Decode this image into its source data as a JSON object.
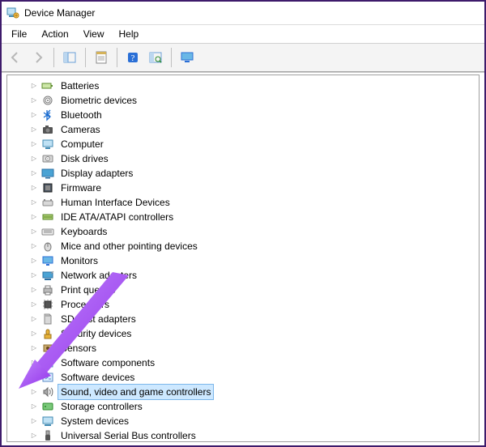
{
  "window": {
    "title": "Device Manager"
  },
  "menu": {
    "items": [
      {
        "key": "file",
        "label": "File"
      },
      {
        "key": "action",
        "label": "Action"
      },
      {
        "key": "view",
        "label": "View"
      },
      {
        "key": "help",
        "label": "Help"
      }
    ]
  },
  "tree": {
    "items": [
      {
        "icon": "battery",
        "label": "Batteries",
        "selected": false
      },
      {
        "icon": "biometric",
        "label": "Biometric devices",
        "selected": false
      },
      {
        "icon": "bluetooth",
        "label": "Bluetooth",
        "selected": false
      },
      {
        "icon": "camera",
        "label": "Cameras",
        "selected": false
      },
      {
        "icon": "computer",
        "label": "Computer",
        "selected": false
      },
      {
        "icon": "disk",
        "label": "Disk drives",
        "selected": false
      },
      {
        "icon": "display",
        "label": "Display adapters",
        "selected": false
      },
      {
        "icon": "firmware",
        "label": "Firmware",
        "selected": false
      },
      {
        "icon": "hid",
        "label": "Human Interface Devices",
        "selected": false
      },
      {
        "icon": "ide",
        "label": "IDE ATA/ATAPI controllers",
        "selected": false
      },
      {
        "icon": "keyboard",
        "label": "Keyboards",
        "selected": false
      },
      {
        "icon": "mouse",
        "label": "Mice and other pointing devices",
        "selected": false
      },
      {
        "icon": "monitor",
        "label": "Monitors",
        "selected": false
      },
      {
        "icon": "network",
        "label": "Network adapters",
        "selected": false
      },
      {
        "icon": "printer",
        "label": "Print queues",
        "selected": false
      },
      {
        "icon": "processor",
        "label": "Processors",
        "selected": false
      },
      {
        "icon": "sd",
        "label": "SD host adapters",
        "selected": false
      },
      {
        "icon": "security",
        "label": "Security devices",
        "selected": false
      },
      {
        "icon": "sensor",
        "label": "Sensors",
        "selected": false
      },
      {
        "icon": "swcomp",
        "label": "Software components",
        "selected": false
      },
      {
        "icon": "swdev",
        "label": "Software devices",
        "selected": false
      },
      {
        "icon": "sound",
        "label": "Sound, video and game controllers",
        "selected": true
      },
      {
        "icon": "storage",
        "label": "Storage controllers",
        "selected": false
      },
      {
        "icon": "system",
        "label": "System devices",
        "selected": false
      },
      {
        "icon": "usb",
        "label": "Universal Serial Bus controllers",
        "selected": false
      }
    ]
  },
  "colors": {
    "arrow": "#a855f7",
    "selection_bg": "#cde8ff",
    "selection_border": "#7bb6ea"
  }
}
